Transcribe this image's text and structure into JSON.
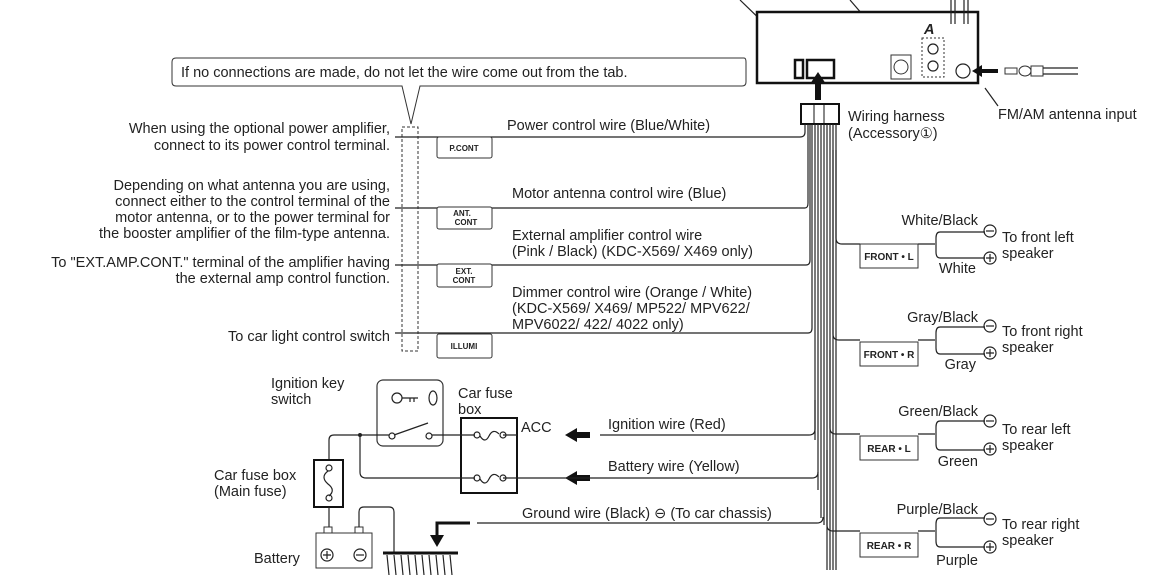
{
  "callout": "If no connections are made, do not let the wire come out from the tab.",
  "head_unit": {
    "label_a": "A"
  },
  "harness": {
    "line1": "Wiring harness",
    "line2": "(Accessory①)"
  },
  "antenna": {
    "label": "FM/AM antenna input"
  },
  "left_notes": {
    "power_amp": [
      "When using the optional power amplifier,",
      "connect to its power control terminal."
    ],
    "antenna": [
      "Depending on what antenna you are using,",
      "connect either to the control terminal of the",
      "motor antenna, or to the power terminal for",
      "the booster amplifier of the film-type antenna."
    ],
    "ext_amp": [
      "To \"EXT.AMP.CONT.\" terminal of the amplifier having",
      "the external amp control function."
    ],
    "light": [
      "To car light control switch"
    ]
  },
  "control_wires": [
    {
      "tab": [
        "P.CONT"
      ],
      "label": [
        "Power control wire (Blue/White)"
      ]
    },
    {
      "tab": [
        "ANT.",
        "CONT"
      ],
      "label": [
        "Motor antenna control wire (Blue)"
      ]
    },
    {
      "tab": [
        "EXT.",
        "CONT"
      ],
      "label": [
        "External amplifier control wire",
        "(Pink / Black) (KDC-X569/ X469 only)"
      ]
    },
    {
      "tab": [
        "ILLUMI"
      ],
      "label": [
        "Dimmer control wire (Orange / White)",
        "(KDC-X569/ X469/ MP522/ MPV622/",
        "MPV6022/ 422/ 4022 only)"
      ]
    }
  ],
  "speakers": [
    {
      "tab": "FRONT • L",
      "neg": "White/Black",
      "pos": "White",
      "target": [
        "To front left",
        "speaker"
      ]
    },
    {
      "tab": "FRONT • R",
      "neg": "Gray/Black",
      "pos": "Gray",
      "target": [
        "To front right",
        "speaker"
      ]
    },
    {
      "tab": "REAR • L",
      "neg": "Green/Black",
      "pos": "Green",
      "target": [
        "To rear left",
        "speaker"
      ]
    },
    {
      "tab": "REAR • R",
      "neg": "Purple/Black",
      "pos": "Purple",
      "target": [
        "To rear right",
        "speaker"
      ]
    }
  ],
  "power": {
    "ignition_key": [
      "Ignition key",
      "switch"
    ],
    "car_fuse_box": [
      "Car fuse",
      "box"
    ],
    "acc": "ACC",
    "ignition_wire": "Ignition wire (Red)",
    "battery_wire": "Battery wire (Yellow)",
    "main_fuse": [
      "Car fuse box",
      "(Main fuse)"
    ],
    "battery": "Battery",
    "ground_wire": "Ground wire (Black) ⊖ (To car chassis)"
  }
}
